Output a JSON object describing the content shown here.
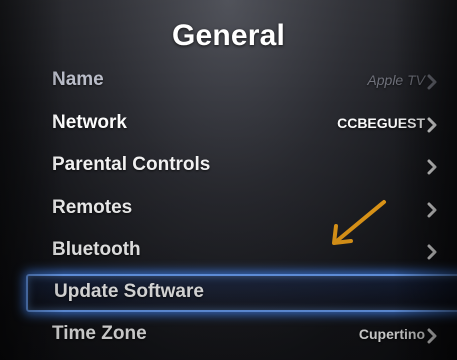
{
  "header": {
    "title": "General"
  },
  "menu": {
    "items": [
      {
        "label": "Name",
        "value": "Apple TV",
        "chevron": true
      },
      {
        "label": "Network",
        "value": "CCBEGUEST",
        "chevron": true
      },
      {
        "label": "Parental Controls",
        "value": "",
        "chevron": true
      },
      {
        "label": "Remotes",
        "value": "",
        "chevron": true
      },
      {
        "label": "Bluetooth",
        "value": "",
        "chevron": true
      },
      {
        "label": "Update Software",
        "value": "",
        "chevron": false
      },
      {
        "label": "Time Zone",
        "value": "Cupertino",
        "chevron": true
      }
    ],
    "selected_index": 5
  },
  "annotation": {
    "arrow_icon": "arrow-down-left-icon",
    "arrow_color": "#f0a21a"
  },
  "colors": {
    "highlight": "#6fa7ff",
    "text": "#ffffff"
  }
}
